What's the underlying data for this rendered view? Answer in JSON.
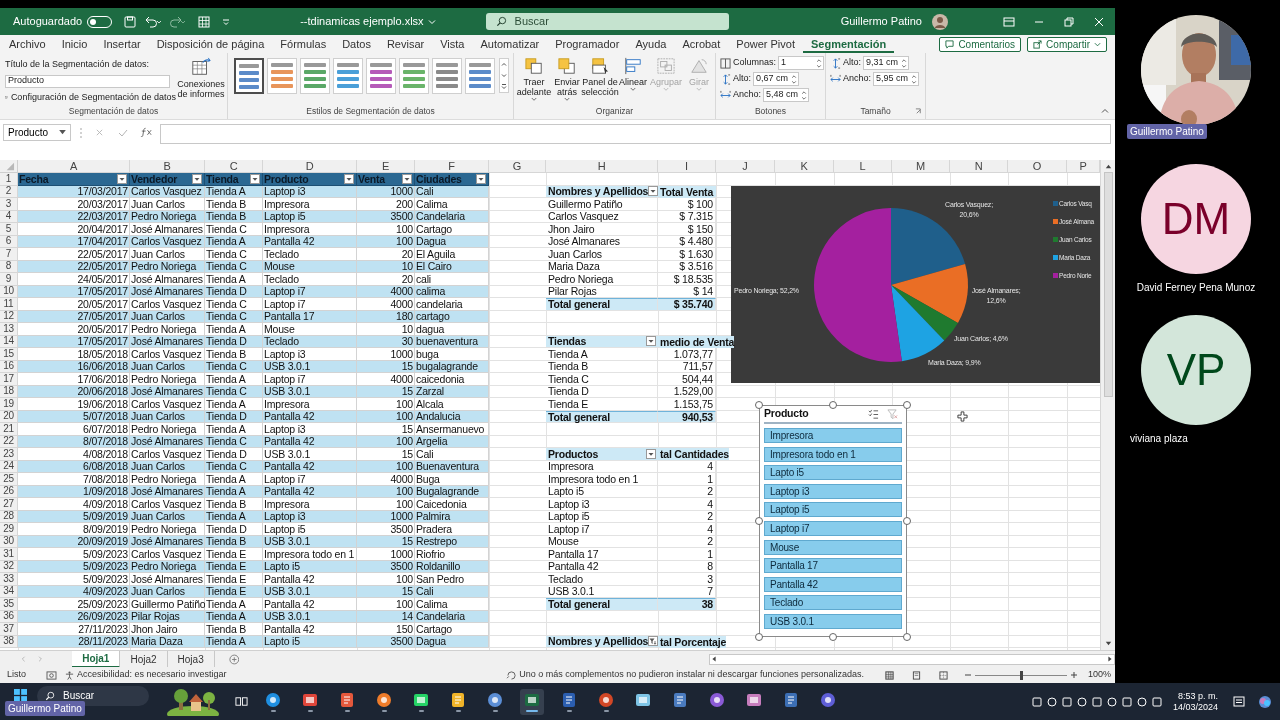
{
  "title_bar": {
    "autosave_label": "Autoguardado",
    "autosave_on": false,
    "file_name": "--tdinamicas ejemplo.xlsx",
    "search_placeholder": "Buscar",
    "user_name": "Guillermo Patino"
  },
  "ribbon_tabs": [
    {
      "label": "Archivo",
      "selected": false
    },
    {
      "label": "Inicio",
      "selected": false
    },
    {
      "label": "Insertar",
      "selected": false
    },
    {
      "label": "Disposición de página",
      "selected": false
    },
    {
      "label": "Fórmulas",
      "selected": false
    },
    {
      "label": "Datos",
      "selected": false
    },
    {
      "label": "Revisar",
      "selected": false
    },
    {
      "label": "Vista",
      "selected": false
    },
    {
      "label": "Automatizar",
      "selected": false
    },
    {
      "label": "Programador",
      "selected": false
    },
    {
      "label": "Ayuda",
      "selected": false
    },
    {
      "label": "Acrobat",
      "selected": false
    },
    {
      "label": "Power Pivot",
      "selected": false
    },
    {
      "label": "Segmentación",
      "selected": true
    }
  ],
  "ribbon_buttons": [
    "Comentarios",
    "Compartir"
  ],
  "ribbon": {
    "slicer_group": {
      "caption_label": "Título de la Segmentación de datos:",
      "caption_value": "Producto",
      "settings_button": "Configuración de Segmentación de datos",
      "connections_button": "Conexiones\nde informes",
      "group_label": "Segmentación de datos"
    },
    "styles_group": {
      "styles": [
        {
          "color": "#5b8bc9",
          "selected": true
        },
        {
          "color": "#e8955a",
          "selected": false
        },
        {
          "color": "#5aa867",
          "selected": false
        },
        {
          "color": "#4a9fd8",
          "selected": false
        },
        {
          "color": "#b55ab8",
          "selected": false
        },
        {
          "color": "#6ab46a",
          "selected": false
        },
        {
          "color": "#8a8a8a",
          "selected": false
        },
        {
          "color": "#5b8bc9",
          "selected": false
        }
      ],
      "group_label": "Estilos de Segmentación de datos"
    },
    "arrange_group": {
      "buttons": [
        {
          "kind": "front",
          "label": "Traer\nadelante",
          "dropdown": true,
          "disabled": false
        },
        {
          "kind": "back",
          "label": "Enviar\natrás",
          "dropdown": true,
          "disabled": false
        },
        {
          "kind": "pane",
          "label": "Panel de\nselección",
          "dropdown": false,
          "disabled": false
        },
        {
          "kind": "align",
          "label": "Alinear",
          "dropdown": true,
          "disabled": false
        },
        {
          "kind": "group",
          "label": "Agrupar",
          "dropdown": true,
          "disabled": true
        },
        {
          "kind": "rotate",
          "label": "Girar",
          "dropdown": true,
          "disabled": true
        }
      ],
      "group_label": "Organizar"
    },
    "buttons_group": {
      "fields": [
        {
          "kind": "columns",
          "label": "Columnas:",
          "value": "1"
        },
        {
          "kind": "height",
          "label": "Alto:",
          "value": "0,67 cm"
        },
        {
          "kind": "width",
          "label": "Ancho:",
          "value": "5,48 cm"
        }
      ],
      "group_label": "Botones"
    },
    "size_group": {
      "fields": [
        {
          "kind": "height",
          "label": "Alto:",
          "value": "9,31 cm"
        },
        {
          "kind": "width",
          "label": "Ancho:",
          "value": "5,95 cm"
        }
      ],
      "group_label": "Tamaño"
    }
  },
  "formula_bar": {
    "name_box": "Producto"
  },
  "sheet": {
    "column_letters": [
      "A",
      "B",
      "C",
      "D",
      "E",
      "F",
      "G",
      "H",
      "I",
      "J",
      "K",
      "L",
      "M",
      "N",
      "O",
      "P"
    ],
    "row_numbers": [
      "1",
      "2",
      "3",
      "4",
      "5",
      "6",
      "7",
      "8",
      "9",
      "10",
      "11",
      "12",
      "13",
      "14",
      "15",
      "16",
      "17",
      "18",
      "19",
      "20",
      "21",
      "22",
      "23",
      "24",
      "25",
      "26",
      "27",
      "28",
      "29",
      "30",
      "31",
      "32",
      "33",
      "34",
      "35",
      "36",
      "37",
      "38"
    ],
    "table": {
      "columns": [
        "Fecha",
        "Vendedor",
        "Tienda",
        "Producto",
        "Venta",
        "Ciudades"
      ],
      "rows": [
        [
          "17/03/2017",
          "Carlos Vasquez",
          "Tienda A",
          "Laptop i3",
          "1000",
          "Cali"
        ],
        [
          "20/03/2017",
          "Juan Carlos",
          "Tienda B",
          "Impresora",
          "200",
          "Calima"
        ],
        [
          "22/03/2017",
          "Pedro Noriega",
          "Tienda B",
          "Laptop i5",
          "3500",
          "Candelaria"
        ],
        [
          "20/04/2017",
          "José Almanares",
          "Tienda C",
          "Impresora",
          "100",
          "Cartago"
        ],
        [
          "17/04/2017",
          "Carlos Vasquez",
          "Tienda A",
          "Pantalla 42",
          "100",
          "Dagua"
        ],
        [
          "22/05/2017",
          "Juan Carlos",
          "Tienda C",
          "Teclado",
          "20",
          "El Aguila"
        ],
        [
          "22/05/2017",
          "Pedro Noriega",
          "Tienda C",
          "Mouse",
          "10",
          "El Cairo"
        ],
        [
          "24/05/2017",
          "José Almanares",
          "Tienda A",
          "Teclado",
          "20",
          "cali"
        ],
        [
          "17/05/2017",
          "José Almanares",
          "Tienda D",
          "Laptop i7",
          "4000",
          "calima"
        ],
        [
          "20/05/2017",
          "Carlos Vasquez",
          "Tienda C",
          "Laptop i7",
          "4000",
          "candelaria"
        ],
        [
          "27/05/2017",
          "Juan Carlos",
          "Tienda C",
          "Pantalla 17",
          "180",
          "cartago"
        ],
        [
          "20/05/2017",
          "Pedro Noriega",
          "Tienda A",
          "Mouse",
          "10",
          "dagua"
        ],
        [
          "17/05/2017",
          "José Almanares",
          "Tienda D",
          "Teclado",
          "30",
          "buenaventura"
        ],
        [
          "18/05/2018",
          "Carlos Vasquez",
          "Tienda B",
          "Laptop i3",
          "1000",
          "buga"
        ],
        [
          "16/06/2018",
          "Juan Carlos",
          "Tienda C",
          "USB 3.0.1",
          "15",
          "bugalagrande"
        ],
        [
          "17/06/2018",
          "Pedro Noriega",
          "Tienda A",
          "Laptop i7",
          "4000",
          "caicedonia"
        ],
        [
          "20/06/2018",
          "José Almanares",
          "Tienda C",
          "USB 3.0.1",
          "15",
          "Zarzal"
        ],
        [
          "19/06/2018",
          "Carlos Vasquez",
          "Tienda A",
          "Impresora",
          "100",
          "Alcala"
        ],
        [
          "5/07/2018",
          "Juan Carlos",
          "Tienda D",
          "Pantalla 42",
          "100",
          "Andalucia"
        ],
        [
          "6/07/2018",
          "Pedro Noriega",
          "Tienda A",
          "Laptop i3",
          "15",
          "Ansermanuevo"
        ],
        [
          "8/07/2018",
          "José Almanares",
          "Tienda C",
          "Pantalla 42",
          "100",
          "Argelia"
        ],
        [
          "4/08/2018",
          "Carlos Vasquez",
          "Tienda D",
          "USB 3.0.1",
          "15",
          "Cali"
        ],
        [
          "6/08/2018",
          "Juan Carlos",
          "Tienda C",
          "Pantalla 42",
          "100",
          "Buenaventura"
        ],
        [
          "7/08/2018",
          "Pedro Noriega",
          "Tienda A",
          "Laptop i7",
          "4000",
          "Buga"
        ],
        [
          "1/09/2018",
          "José Almanares",
          "Tienda A",
          "Pantalla 42",
          "100",
          "Bugalagrande"
        ],
        [
          "4/09/2018",
          "Carlos Vasquez",
          "Tienda B",
          "Impresora",
          "100",
          "Caicedonia"
        ],
        [
          "5/09/2019",
          "Juan Carlos",
          "Tienda A",
          "Laptop i3",
          "1000",
          "Palmira"
        ],
        [
          "8/09/2019",
          "Pedro Noriega",
          "Tienda D",
          "Laptop i5",
          "3500",
          "Pradera"
        ],
        [
          "20/09/2019",
          "José Almanares",
          "Tienda B",
          "USB 3.0.1",
          "15",
          "Restrepo"
        ],
        [
          "5/09/2023",
          "Carlos Vasquez",
          "Tienda E",
          "Impresora todo en 1",
          "1000",
          "Riofrio"
        ],
        [
          "5/09/2023",
          "Pedro Noriega",
          "Tienda E",
          "Lapto i5",
          "3500",
          "Roldanillo"
        ],
        [
          "5/09/2023",
          "José Almanares",
          "Tienda E",
          "Pantalla 42",
          "100",
          "San Pedro"
        ],
        [
          "4/09/2023",
          "Juan Carlos",
          "Tienda E",
          "USB 3.0.1",
          "15",
          "Cali"
        ],
        [
          "25/09/2023",
          "Guillermo Patiño",
          "Tienda A",
          "Pantalla 42",
          "100",
          "Calima"
        ],
        [
          "26/09/2023",
          "Pilar Rojas",
          "Tienda A",
          "USB 3.0.1",
          "14",
          "Candelaria"
        ],
        [
          "27/11/2023",
          "Jhon Jairo",
          "Tienda B",
          "Pantalla 42",
          "150",
          "Cartago"
        ],
        [
          "28/11/2023",
          "Maria Daza",
          "Tienda A",
          "Lapto i5",
          "3500",
          "Dagua"
        ]
      ]
    },
    "pivots": [
      {
        "row_label": "Nombres y Apellidos",
        "value_label": "Total Venta",
        "filtered": false,
        "rows": [
          [
            "Guillermo Patiño",
            "$ 100"
          ],
          [
            "Carlos Vasquez",
            "$ 7.315"
          ],
          [
            "Jhon Jairo",
            "$ 150"
          ],
          [
            "José Almanares",
            "$ 4.480"
          ],
          [
            "Juan Carlos",
            "$ 1.630"
          ],
          [
            "Maria Daza",
            "$ 3.516"
          ],
          [
            "Pedro Noriega",
            "$ 18.535"
          ],
          [
            "Pilar Rojas",
            "$ 14"
          ]
        ],
        "total": [
          "Total general",
          "$ 35.740"
        ]
      },
      {
        "row_label": "Tiendas",
        "value_label": "medio de Venta",
        "filtered": false,
        "rows": [
          [
            "Tienda A",
            "1.073,77"
          ],
          [
            "Tienda B",
            "711,57"
          ],
          [
            "Tienda C",
            "504,44"
          ],
          [
            "Tienda D",
            "1.529,00"
          ],
          [
            "Tienda E",
            "1.153,75"
          ]
        ],
        "total": [
          "Total general",
          "940,53"
        ]
      },
      {
        "row_label": "Productos",
        "value_label": "tal Cantidades",
        "filtered": false,
        "rows": [
          [
            "Impresora",
            "4"
          ],
          [
            "Impresora todo en 1",
            "1"
          ],
          [
            "Lapto i5",
            "2"
          ],
          [
            "Laptop i3",
            "4"
          ],
          [
            "Laptop i5",
            "2"
          ],
          [
            "Laptop i7",
            "4"
          ],
          [
            "Mouse",
            "2"
          ],
          [
            "Pantalla 17",
            "1"
          ],
          [
            "Pantalla 42",
            "8"
          ],
          [
            "Teclado",
            "3"
          ],
          [
            "USB 3.0.1",
            "7"
          ]
        ],
        "total": [
          "Total general",
          "38"
        ]
      },
      {
        "row_label": "Nombres y Apellidos",
        "value_label": "tal Porcentaje",
        "filtered": true
      }
    ],
    "chart": {
      "chart_data": {
        "type": "pie",
        "categories": [
          "Carlos Vasquez",
          "José Almanares",
          "Juan Carlos",
          "Maria Daza",
          "Pedro Noriega"
        ],
        "values": [
          20.6,
          12.6,
          4.6,
          9.9,
          52.2
        ],
        "colors": [
          "#1f5f8b",
          "#ea6e25",
          "#1f7a2f",
          "#1ea3e3",
          "#a4209f"
        ],
        "value_labels": [
          "20,6%",
          "12,6%",
          "4,6%",
          "9,9%",
          "52,2%"
        ],
        "legend": "right"
      },
      "data_label_separator": ";",
      "legend_labels": [
        "Carlos Vasq",
        "José Almana",
        "Juan Carlos",
        "Maria Daza",
        "Pedro Norie"
      ]
    },
    "slicer": {
      "title": "Producto",
      "items": [
        {
          "label": "Impresora",
          "selected": true
        },
        {
          "label": "Impresora todo en 1",
          "selected": true
        },
        {
          "label": "Lapto i5",
          "selected": true
        },
        {
          "label": "Laptop i3",
          "selected": true
        },
        {
          "label": "Laptop i5",
          "selected": true
        },
        {
          "label": "Laptop i7",
          "selected": true
        },
        {
          "label": "Mouse",
          "selected": true
        },
        {
          "label": "Pantalla 17",
          "selected": true
        },
        {
          "label": "Pantalla 42",
          "selected": true
        },
        {
          "label": "Teclado",
          "selected": true
        },
        {
          "label": "USB 3.0.1",
          "selected": true
        }
      ]
    }
  },
  "sheet_tabs": [
    {
      "label": "Hoja1",
      "selected": true
    },
    {
      "label": "Hoja2",
      "selected": false
    },
    {
      "label": "Hoja3",
      "selected": false
    }
  ],
  "status_bar": {
    "ready": "Listo",
    "accessibility": "Accesibilidad: es necesario investigar",
    "message": "Uno o más complementos no pudieron instalar ni descargar funciones personalizadas.",
    "zoom": {
      "level": 0.5,
      "reading": "100%"
    }
  },
  "taskbar": {
    "search_placeholder": "Buscar",
    "time": "8:53 p. m.",
    "date": "14/03/2024",
    "presenter_label": "Guillermo Patino"
  },
  "participants": [
    {
      "kind": "video",
      "name": "Guillermo Patino"
    },
    {
      "kind": "initials",
      "initials": "DM",
      "name": "David Ferney Pena Munoz",
      "color": "#f6d6e1"
    },
    {
      "kind": "initials",
      "initials": "VP",
      "name": "viviana plaza",
      "color": "#d3e6da"
    }
  ]
}
